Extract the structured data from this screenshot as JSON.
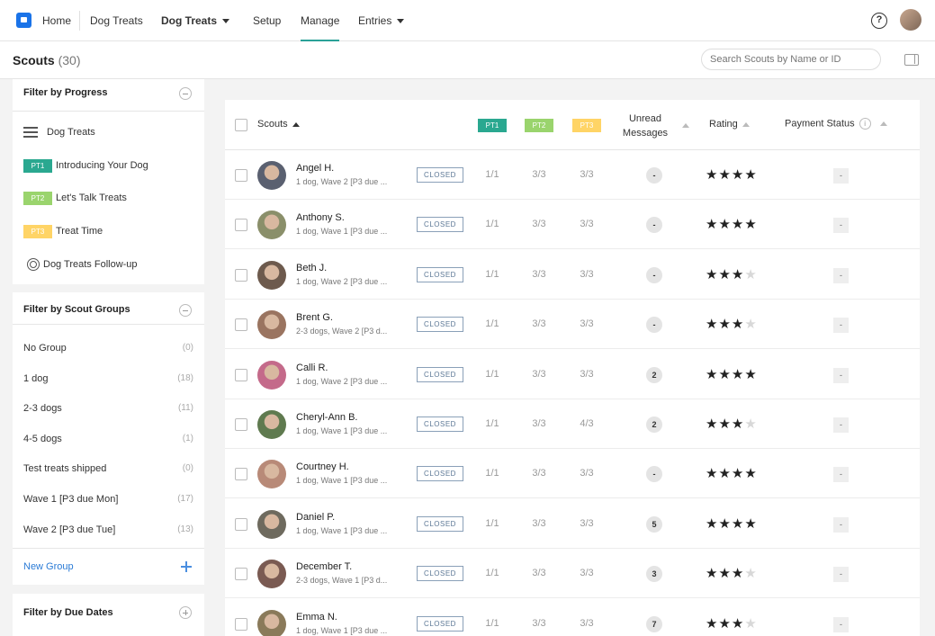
{
  "nav": {
    "home": "Home",
    "dog_treats_1": "Dog Treats",
    "dog_treats_2": "Dog Treats",
    "setup": "Setup",
    "manage": "Manage",
    "entries": "Entries",
    "help": "?"
  },
  "header": {
    "title": "Scouts",
    "count": "(30)",
    "search_placeholder": "Search Scouts by Name or ID"
  },
  "progress_filter": {
    "title": "Filter by Progress",
    "all_label": "Dog Treats",
    "pt1_tag": "PT1",
    "pt1_label": "Introducing Your Dog",
    "pt2_tag": "PT2",
    "pt2_label": "Let's Talk Treats",
    "pt3_tag": "PT3",
    "pt3_label": "Treat Time",
    "followup_label": "Dog Treats Follow-up"
  },
  "groups_filter": {
    "title": "Filter by Scout Groups",
    "items": [
      {
        "label": "No Group",
        "count": "(0)"
      },
      {
        "label": "1 dog",
        "count": "(18)"
      },
      {
        "label": "2-3 dogs",
        "count": "(11)"
      },
      {
        "label": "4-5 dogs",
        "count": "(1)"
      },
      {
        "label": "Test treats shipped",
        "count": "(0)"
      },
      {
        "label": "Wave 1 [P3 due Mon]",
        "count": "(17)"
      },
      {
        "label": "Wave 2 [P3 due Tue]",
        "count": "(13)"
      }
    ],
    "new_group": "New Group"
  },
  "due_filter": {
    "title": "Filter by Due Dates"
  },
  "table": {
    "col_scouts": "Scouts",
    "col_pt1": "PT1",
    "col_pt2": "PT2",
    "col_pt3": "PT3",
    "col_unread_1": "Unread",
    "col_unread_2": "Messages",
    "col_rating": "Rating",
    "col_payment": "Payment Status",
    "info": "i",
    "rows": [
      {
        "name": "Angel H.",
        "sub": "1 dog, Wave 2 [P3 due ...",
        "status": "CLOSED",
        "pt1": "1/1",
        "pt2": "3/3",
        "pt3": "3/3",
        "unread": "-",
        "rating": 4,
        "payment": "-",
        "avatar": "#5a6070"
      },
      {
        "name": "Anthony S.",
        "sub": "1 dog, Wave 1 [P3 due ...",
        "status": "CLOSED",
        "pt1": "1/1",
        "pt2": "3/3",
        "pt3": "3/3",
        "unread": "-",
        "rating": 4,
        "payment": "-",
        "avatar": "#8a8f6a"
      },
      {
        "name": "Beth J.",
        "sub": "1 dog, Wave 2 [P3 due ...",
        "status": "CLOSED",
        "pt1": "1/1",
        "pt2": "3/3",
        "pt3": "3/3",
        "unread": "-",
        "rating": 3,
        "payment": "-",
        "avatar": "#6d5a4d"
      },
      {
        "name": "Brent G.",
        "sub": "2-3 dogs, Wave 2 [P3 d...",
        "status": "CLOSED",
        "pt1": "1/1",
        "pt2": "3/3",
        "pt3": "3/3",
        "unread": "-",
        "rating": 3,
        "payment": "-",
        "avatar": "#9a7460"
      },
      {
        "name": "Calli R.",
        "sub": "1 dog, Wave 2 [P3 due ...",
        "status": "CLOSED",
        "pt1": "1/1",
        "pt2": "3/3",
        "pt3": "3/3",
        "unread": "2",
        "rating": 4,
        "payment": "-",
        "avatar": "#c46a8a"
      },
      {
        "name": "Cheryl-Ann B.",
        "sub": "1 dog, Wave 1 [P3 due ...",
        "status": "CLOSED",
        "pt1": "1/1",
        "pt2": "3/3",
        "pt3": "4/3",
        "unread": "2",
        "rating": 3,
        "payment": "-",
        "avatar": "#5f7a4f"
      },
      {
        "name": "Courtney H.",
        "sub": "1 dog, Wave 1 [P3 due ...",
        "status": "CLOSED",
        "pt1": "1/1",
        "pt2": "3/3",
        "pt3": "3/3",
        "unread": "-",
        "rating": 4,
        "payment": "-",
        "avatar": "#b88a78"
      },
      {
        "name": "Daniel P.",
        "sub": "1 dog, Wave 1 [P3 due ...",
        "status": "CLOSED",
        "pt1": "1/1",
        "pt2": "3/3",
        "pt3": "3/3",
        "unread": "5",
        "rating": 4,
        "payment": "-",
        "avatar": "#6e6a5e"
      },
      {
        "name": "December T.",
        "sub": "2-3 dogs, Wave 1 [P3 d...",
        "status": "CLOSED",
        "pt1": "1/1",
        "pt2": "3/3",
        "pt3": "3/3",
        "unread": "3",
        "rating": 3,
        "payment": "-",
        "avatar": "#7a5a52"
      },
      {
        "name": "Emma N.",
        "sub": "1 dog, Wave 1 [P3 due ...",
        "status": "CLOSED",
        "pt1": "1/1",
        "pt2": "3/3",
        "pt3": "3/3",
        "unread": "7",
        "rating": 3,
        "payment": "-",
        "avatar": "#8a7a5a"
      }
    ]
  }
}
